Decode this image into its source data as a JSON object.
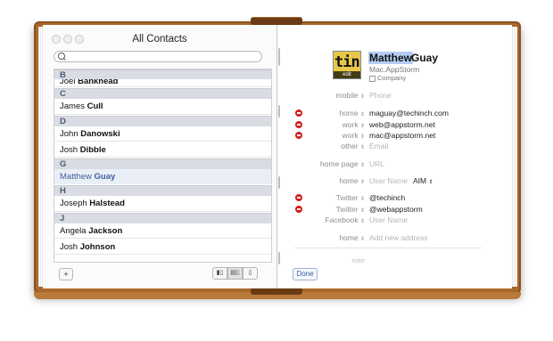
{
  "window": {
    "title": "All Contacts"
  },
  "search": {
    "placeholder": ""
  },
  "contacts": [
    {
      "type": "header",
      "text": "B"
    },
    {
      "type": "contact",
      "first": "Joel",
      "last": "Bankhead"
    },
    {
      "type": "header",
      "text": "C"
    },
    {
      "type": "contact",
      "first": "James",
      "last": "Cull"
    },
    {
      "type": "header",
      "text": "D"
    },
    {
      "type": "contact",
      "first": "John",
      "last": "Danowski"
    },
    {
      "type": "contact",
      "first": "Josh",
      "last": "Dibble"
    },
    {
      "type": "header",
      "text": "G"
    },
    {
      "type": "contact",
      "first": "Matthew",
      "last": "Guay",
      "selected": true
    },
    {
      "type": "header",
      "text": "H"
    },
    {
      "type": "contact",
      "first": "Joseph",
      "last": "Halstead"
    },
    {
      "type": "header",
      "text": "J"
    },
    {
      "type": "contact",
      "first": "Angela",
      "last": "Jackson"
    },
    {
      "type": "contact",
      "first": "Josh",
      "last": "Johnson"
    }
  ],
  "bottom_bar": {
    "add_label": "+",
    "view_buttons": [
      "▮▯",
      "▤▯",
      "▯"
    ]
  },
  "card": {
    "avatar_text": "tin",
    "avatar_edit": "edit",
    "first_name": "Matthew",
    "last_name": "Guay",
    "company_placeholder": "Mac.AppStorm",
    "company_checkbox_label": "Company",
    "fields": [
      {
        "label": "mobile",
        "value": "Phone",
        "placeholder": true,
        "remove": false
      },
      {
        "label": "home",
        "value": "maguay@techinch.com",
        "placeholder": false,
        "remove": true
      },
      {
        "label": "work",
        "value": "web@appstorm.net",
        "placeholder": false,
        "remove": true
      },
      {
        "label": "work",
        "value": "mac@appstorm.net",
        "placeholder": false,
        "remove": true
      },
      {
        "label": "other",
        "value": "Email",
        "placeholder": true,
        "remove": false
      },
      {
        "label": "home page",
        "value": "URL",
        "placeholder": true,
        "remove": false
      },
      {
        "label": "home",
        "value": "User Name",
        "placeholder": true,
        "remove": false,
        "service": "AIM"
      },
      {
        "label": "Twitter",
        "value": "@techinch",
        "placeholder": false,
        "remove": true
      },
      {
        "label": "Twitter",
        "value": "@webappstorm",
        "placeholder": false,
        "remove": true
      },
      {
        "label": "Facebook",
        "value": "User Name",
        "placeholder": true,
        "remove": false
      },
      {
        "label": "home",
        "value": "Add new address",
        "placeholder": true,
        "remove": false
      }
    ],
    "note_label": "note",
    "done_label": "Done"
  },
  "colors": {
    "selection": "#3d5f9b",
    "remove": "#d41e1e",
    "book": "#a9692a"
  }
}
